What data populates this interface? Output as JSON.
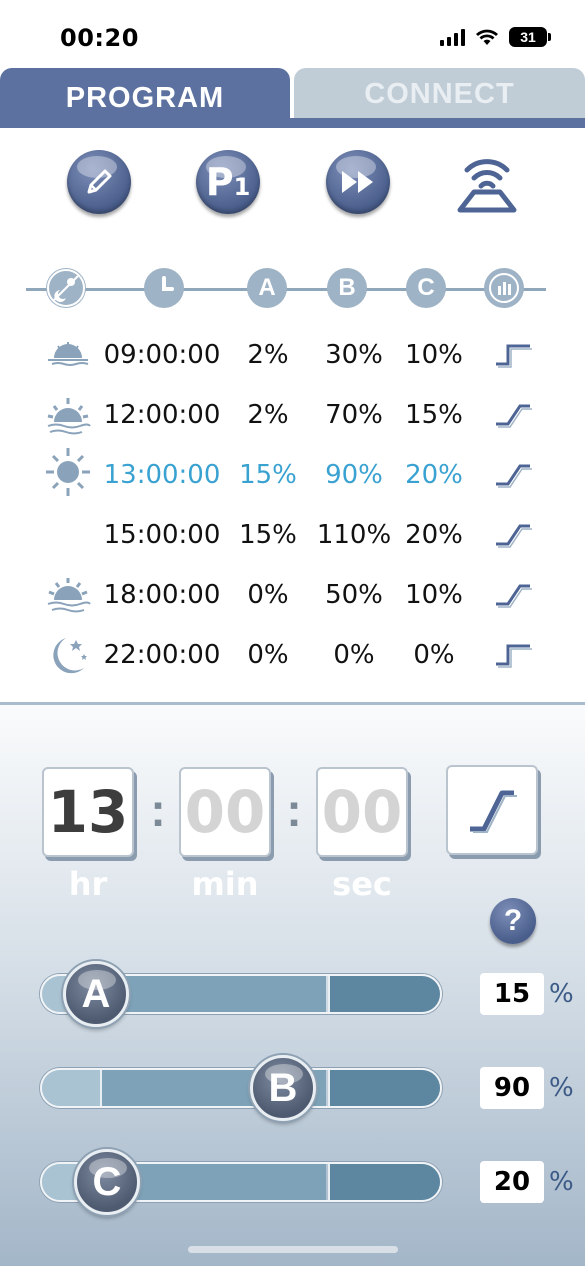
{
  "status": {
    "time": "00:20",
    "battery": "31"
  },
  "tabs": [
    {
      "label": "PROGRAM"
    },
    {
      "label": "CONNECT"
    }
  ],
  "toolbar": [
    {
      "icon": "edit-icon"
    },
    {
      "icon": "program-p1-icon",
      "label": "P",
      "sub": "1"
    },
    {
      "icon": "fast-forward-icon"
    },
    {
      "icon": "wireless-device-icon"
    }
  ],
  "columns": [
    "A",
    "B",
    "C"
  ],
  "rows": [
    {
      "icon": "sunrise-icon",
      "time": "09:00:00",
      "a": "2%",
      "b": "30%",
      "c": "10%",
      "ramp": "step",
      "selected": false
    },
    {
      "icon": "morning-sun-icon",
      "time": "12:00:00",
      "a": "2%",
      "b": "70%",
      "c": "15%",
      "ramp": "ramp",
      "selected": false
    },
    {
      "icon": "full-sun-icon",
      "time": "13:00:00",
      "a": "15%",
      "b": "90%",
      "c": "20%",
      "ramp": "ramp",
      "selected": true
    },
    {
      "icon": "",
      "time": "15:00:00",
      "a": "15%",
      "b": "110%",
      "c": "20%",
      "ramp": "ramp",
      "selected": false
    },
    {
      "icon": "sunset-icon",
      "time": "18:00:00",
      "a": "0%",
      "b": "50%",
      "c": "10%",
      "ramp": "ramp",
      "selected": false
    },
    {
      "icon": "moon-icon",
      "time": "22:00:00",
      "a": "0%",
      "b": "0%",
      "c": "0%",
      "ramp": "step",
      "selected": false
    }
  ],
  "editor": {
    "hr": "13",
    "min": "00",
    "sec": "00",
    "hr_label": "hr",
    "min_label": "min",
    "sec_label": "sec",
    "help": "?"
  },
  "sliders": [
    {
      "label": "A",
      "value": "15",
      "level": 0.15
    },
    {
      "label": "B",
      "value": "90",
      "level": 0.9
    },
    {
      "label": "C",
      "value": "20",
      "level": 0.2
    }
  ],
  "percent_sign": "%",
  "colors": {
    "accent": "#5c71a0",
    "selected_text": "#3aa2d1",
    "tab_inactive": "#c0ccd6"
  }
}
